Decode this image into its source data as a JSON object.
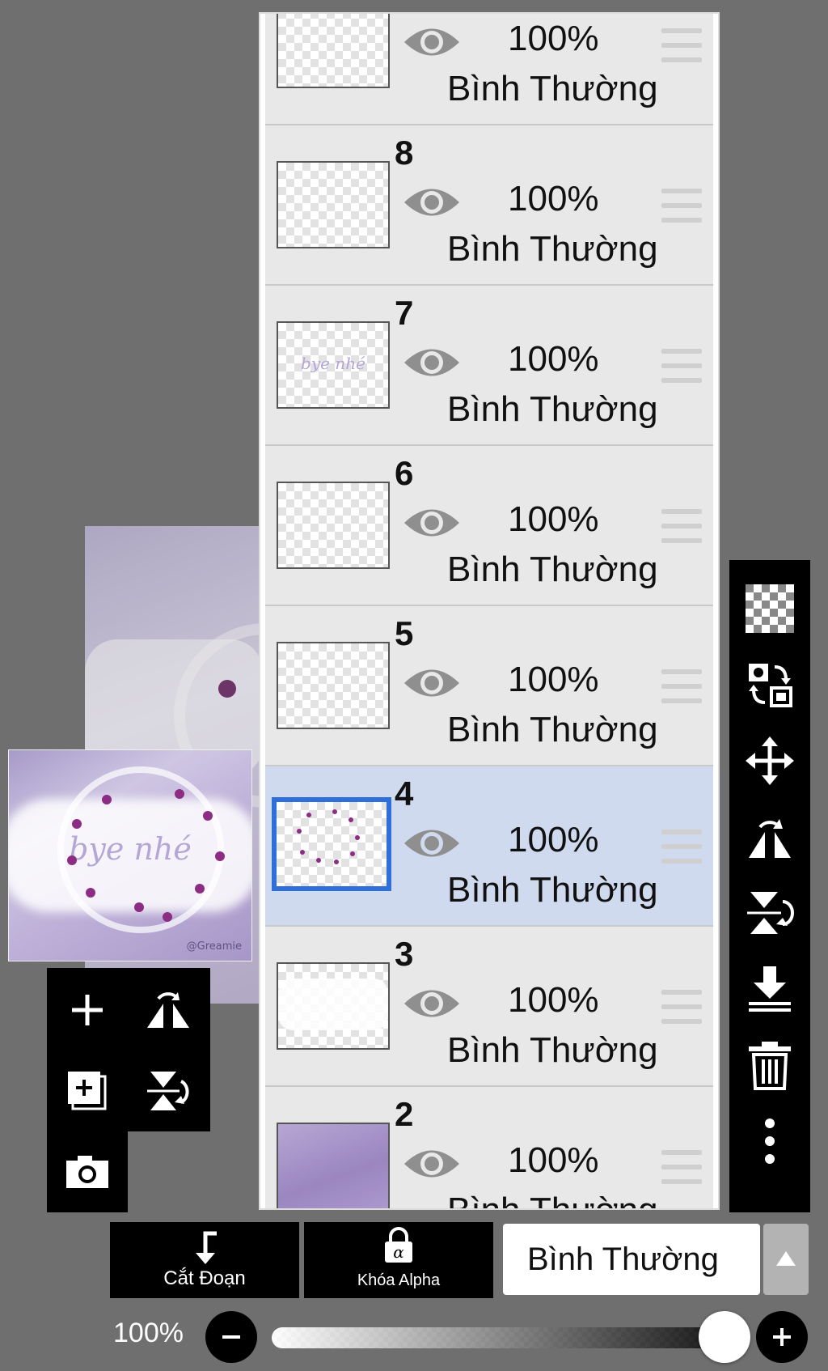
{
  "layers": [
    {
      "number": "",
      "opacity": "100%",
      "blend": "Bình Thường"
    },
    {
      "number": "8",
      "opacity": "100%",
      "blend": "Bình Thường"
    },
    {
      "number": "7",
      "opacity": "100%",
      "blend": "Bình Thường",
      "thumb_text": "bye nhé"
    },
    {
      "number": "6",
      "opacity": "100%",
      "blend": "Bình Thường"
    },
    {
      "number": "5",
      "opacity": "100%",
      "blend": "Bình Thường"
    },
    {
      "number": "4",
      "opacity": "100%",
      "blend": "Bình Thường",
      "selected": true
    },
    {
      "number": "3",
      "opacity": "100%",
      "blend": "Bình Thường"
    },
    {
      "number": "2",
      "opacity": "100%",
      "blend": "Bình Thường"
    }
  ],
  "preview": {
    "title_text": "bye nhé",
    "signature": "@Greamie"
  },
  "actions": {
    "clip_label": "Cắt Đoạn",
    "alpha_lock_label": "Khóa Alpha",
    "alpha_symbol": "α"
  },
  "blend_mode": {
    "selected": "Bình Thường"
  },
  "opacity_slider": {
    "label": "100%",
    "value_fraction": 1.0
  },
  "colors": {
    "selected_layer_bg": "#cfdaef",
    "selection_border": "#2e6fd9",
    "background": "#6f6f6f"
  },
  "icons": {
    "left_tools": [
      "add-layer-icon",
      "flip-horizontal-icon",
      "duplicate-layer-icon",
      "flip-vertical-icon",
      "camera-icon"
    ],
    "right_tools": [
      "transparency-icon",
      "swap-icon",
      "move-icon",
      "flip-horizontal-icon",
      "flip-vertical-icon",
      "merge-down-icon",
      "trash-icon",
      "more-icon"
    ]
  }
}
